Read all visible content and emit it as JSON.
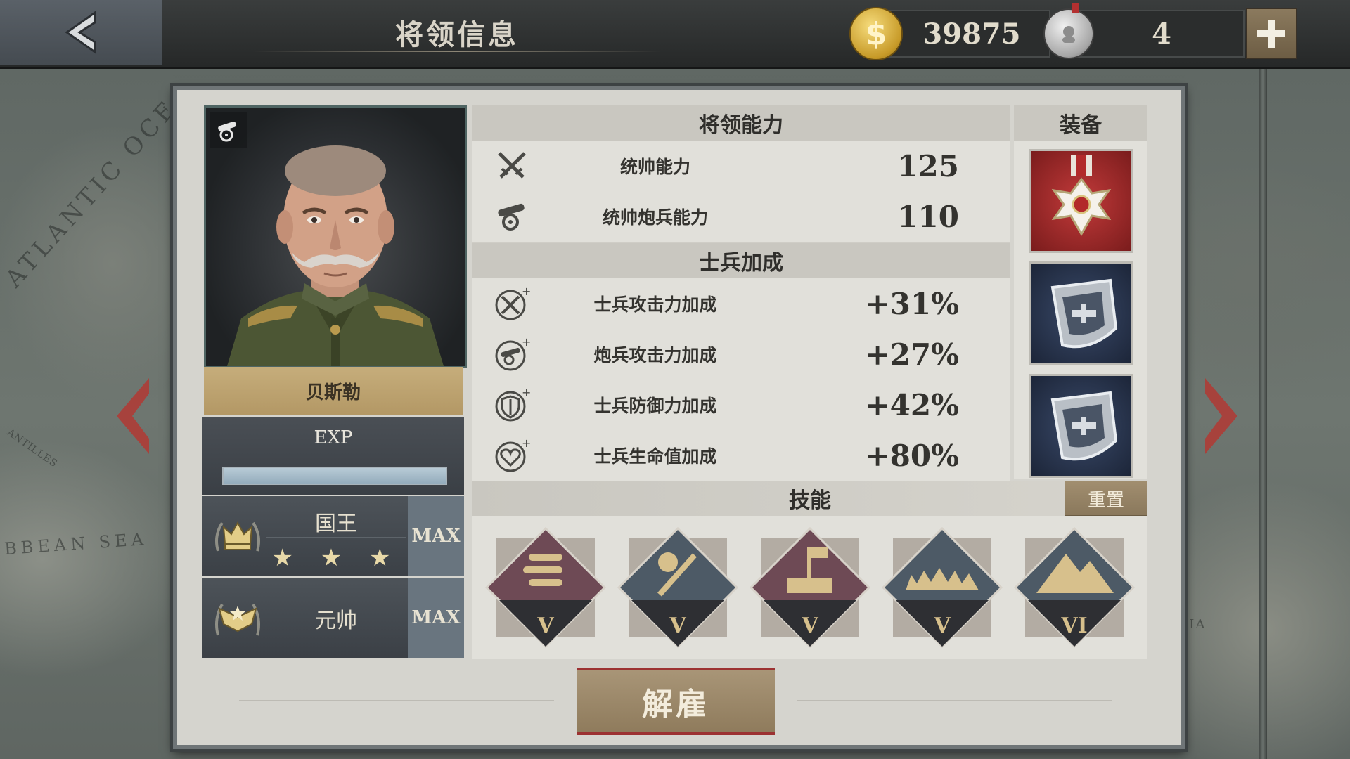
{
  "header": {
    "title": "将领信息",
    "gold": "39875",
    "medals": "4"
  },
  "general": {
    "name": "贝斯勒",
    "exp_label": "EXP",
    "exp_progress": 1.0,
    "titles": [
      {
        "name": "国王",
        "stars": "★ ★ ★",
        "level": "MAX"
      },
      {
        "name": "元帅",
        "level": "MAX"
      }
    ]
  },
  "abilities": {
    "header": "将领能力",
    "rows": [
      {
        "icon": "crossed-swords-icon",
        "label": "统帅能力",
        "value": "125"
      },
      {
        "icon": "cannon-icon",
        "label": "统帅炮兵能力",
        "value": "110"
      }
    ]
  },
  "bonuses": {
    "header": "士兵加成",
    "rows": [
      {
        "icon": "swords-plus-icon",
        "label": "士兵攻击力加成",
        "value": "+31%"
      },
      {
        "icon": "cannon-plus-icon",
        "label": "炮兵攻击力加成",
        "value": "+27%"
      },
      {
        "icon": "shield-plus-icon",
        "label": "士兵防御力加成",
        "value": "+42%"
      },
      {
        "icon": "heart-plus-icon",
        "label": "士兵生命值加成",
        "value": "+80%"
      }
    ]
  },
  "equipment": {
    "header": "装备",
    "items": [
      "red-cross-medal-icon",
      "silver-badge-icon",
      "silver-badge-icon"
    ]
  },
  "skills": {
    "header": "技能",
    "reset_label": "重置",
    "items": [
      {
        "icon": "ammo-skill-icon",
        "level": "V",
        "color": "#6e4a55"
      },
      {
        "icon": "melee-skill-icon",
        "level": "V",
        "color": "#4d5a66"
      },
      {
        "icon": "fortify-skill-icon",
        "level": "V",
        "color": "#6e4a55"
      },
      {
        "icon": "trench-skill-icon",
        "level": "V",
        "color": "#4d5a66"
      },
      {
        "icon": "mountain-skill-icon",
        "level": "VI",
        "color": "#4d5a66"
      }
    ]
  },
  "actions": {
    "dismiss_label": "解雇"
  },
  "map_labels": {
    "ocean": "ATLANTIC OCE",
    "sea": "BBEAN SEA",
    "islands": "ANTILLES",
    "right": "BIA"
  },
  "colors": {
    "accent_gold": "#c6ad7b",
    "button_brown": "#8f7b5c",
    "red_border": "#9c3232"
  }
}
